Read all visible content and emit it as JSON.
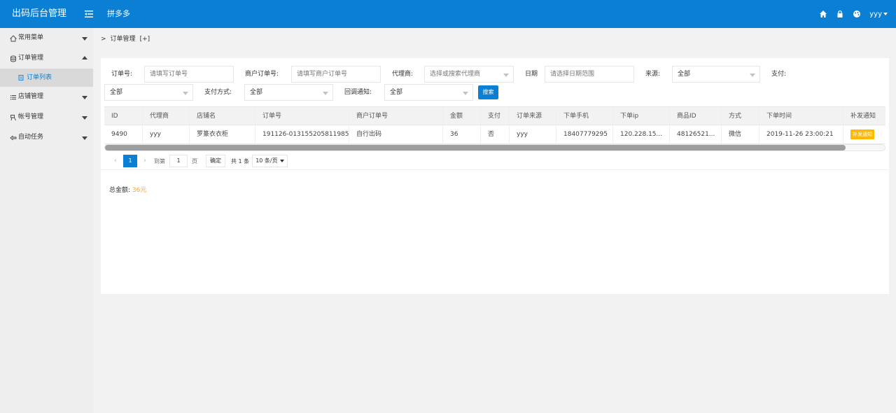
{
  "header": {
    "logo": "出码后台管理",
    "app_title": "拼多多",
    "user": "yyy"
  },
  "sidebar": {
    "items": [
      {
        "label": "常用菜单",
        "icon": "home-icon",
        "expanded": false
      },
      {
        "label": "订单管理",
        "icon": "database-icon",
        "expanded": true
      },
      {
        "label": "订单列表",
        "icon": "file-icon",
        "sub": true,
        "active": true
      },
      {
        "label": "店铺管理",
        "icon": "list-icon",
        "expanded": false
      },
      {
        "label": "帐号管理",
        "icon": "user-icon",
        "expanded": false
      },
      {
        "label": "自动任务",
        "icon": "link-icon",
        "expanded": false
      }
    ]
  },
  "breadcrumb": {
    "sep": ">",
    "current": "订单管理",
    "extra": "[+]"
  },
  "filters": {
    "order_no_label": "订单号:",
    "order_no_placeholder": "请填写订单号",
    "merchant_order_label": "商户订单号:",
    "merchant_order_placeholder": "请填写商户订单号",
    "agent_label": "代理商:",
    "agent_placeholder": "选择或搜索代理商",
    "date_label": "日期",
    "date_placeholder": "请选择日期范围",
    "source_label": "来源:",
    "source_value": "全部",
    "pay_label": "支付:",
    "pay_value": "全部",
    "pay_method_label": "支付方式:",
    "pay_method_value": "全部",
    "callback_label": "回调通知:",
    "callback_value": "全部",
    "search_button": "搜索"
  },
  "table": {
    "columns": [
      "ID",
      "代理商",
      "店铺名",
      "订单号",
      "商户订单号",
      "金额",
      "支付",
      "订单来源",
      "下单手机",
      "下单ip",
      "商品ID",
      "方式",
      "下单时间",
      "补发通知"
    ],
    "rows": [
      [
        "9490",
        "yyy",
        "罗篆衣衣柜",
        "191126-013155205811985",
        "自行出码",
        "36",
        "否",
        "yyy",
        "18407779295",
        "120.228.15...",
        "48126521...",
        "微信",
        "2019-11-26 23:00:21",
        "补发通知"
      ]
    ],
    "scroll_fraction": 0.95
  },
  "pager": {
    "prev": "‹",
    "current": "1",
    "next": "›",
    "goto_label": "到第",
    "goto_value": "1",
    "page_label": "页",
    "confirm": "确定",
    "total": "共 1 条",
    "page_size": "10 条/页"
  },
  "summary": {
    "label": "总金额:",
    "amount": "36元"
  },
  "colors": {
    "primary": "#0b7fd4",
    "warning": "#ffb800",
    "amount": "#f2a33a"
  }
}
